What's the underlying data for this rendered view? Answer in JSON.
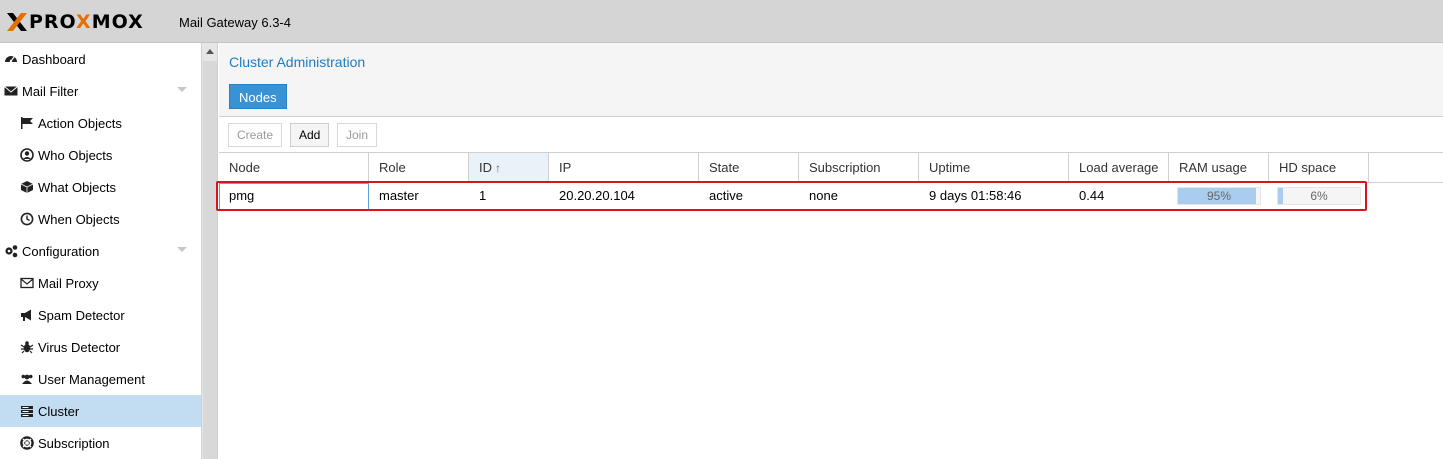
{
  "app": {
    "logo_pre": "PRO",
    "logo_x": "X",
    "logo_post": "MOX",
    "product": "Mail Gateway 6.3-4"
  },
  "sidebar": {
    "items": [
      {
        "label": "Dashboard",
        "icon": "dashboard-icon"
      },
      {
        "label": "Mail Filter",
        "icon": "envelope-icon"
      },
      {
        "label": "Action Objects",
        "icon": "flag-icon"
      },
      {
        "label": "Who Objects",
        "icon": "user-circle-icon"
      },
      {
        "label": "What Objects",
        "icon": "cube-icon"
      },
      {
        "label": "When Objects",
        "icon": "clock-icon"
      },
      {
        "label": "Configuration",
        "icon": "cogs-icon"
      },
      {
        "label": "Mail Proxy",
        "icon": "envelope-outline-icon"
      },
      {
        "label": "Spam Detector",
        "icon": "bullhorn-icon"
      },
      {
        "label": "Virus Detector",
        "icon": "bug-icon"
      },
      {
        "label": "User Management",
        "icon": "users-icon"
      },
      {
        "label": "Cluster",
        "icon": "server-icon"
      },
      {
        "label": "Subscription",
        "icon": "lifebuoy-icon"
      }
    ],
    "selected": "Cluster"
  },
  "main": {
    "title": "Cluster Administration",
    "tab": "Nodes",
    "toolbar": {
      "create": "Create",
      "add": "Add",
      "join": "Join"
    },
    "columns": [
      "Node",
      "Role",
      "ID",
      "IP",
      "State",
      "Subscription",
      "Uptime",
      "Load average",
      "RAM usage",
      "HD space"
    ],
    "sort_arrow": "↑",
    "rows": [
      {
        "node": "pmg",
        "role": "master",
        "id": "1",
        "ip": "20.20.20.104",
        "state": "active",
        "subscription": "none",
        "uptime": "9 days 01:58:46",
        "load": "0.44",
        "ram_usage": 0.95,
        "ram_label": "95%",
        "hd_space": 0.06,
        "hd_label": "6%"
      }
    ]
  },
  "colors": {
    "accent": "#3892d4",
    "title": "#1e7cc4",
    "selection": "#c2ddf2",
    "highlight": "#d9141a",
    "logo_orange": "#e57000"
  }
}
